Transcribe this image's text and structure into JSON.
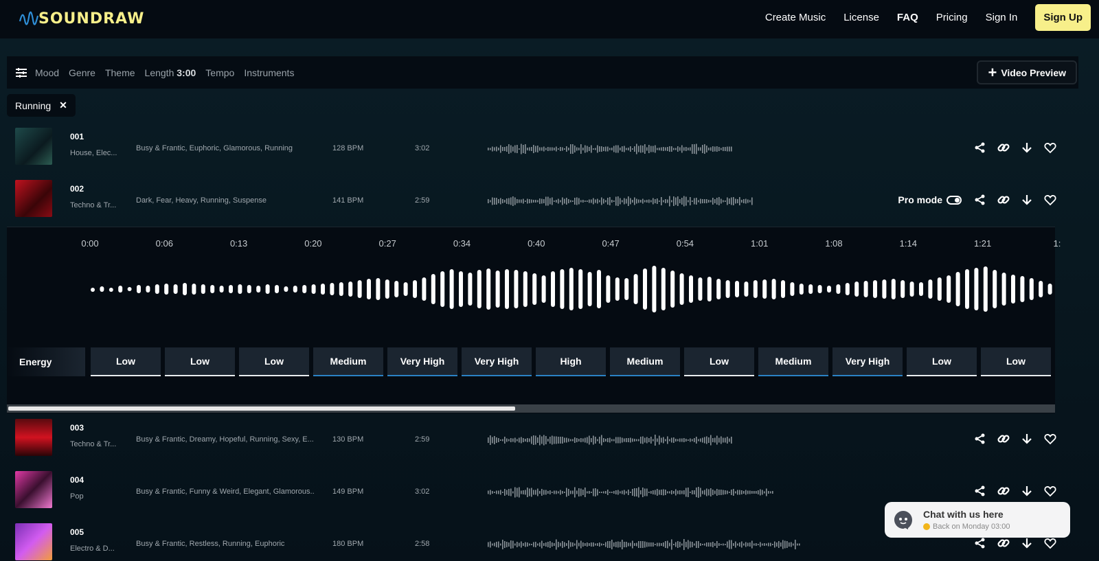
{
  "header": {
    "logo_text": "SOUNDRAW",
    "nav": [
      "Create Music",
      "License",
      "FAQ",
      "Pricing",
      "Sign In"
    ],
    "signup_label": "Sign Up"
  },
  "filters": {
    "items": [
      "Mood",
      "Genre",
      "Theme"
    ],
    "length_label": "Length",
    "length_value": "3:00",
    "tempo": "Tempo",
    "instruments": "Instruments",
    "video_preview": "Video Preview"
  },
  "active_chip": "Running",
  "tracks": [
    {
      "num": "001",
      "genre": "House, Elec...",
      "moods": "Busy & Frantic, Euphoric, Glamorous, Running",
      "bpm": "128 BPM",
      "duration": "3:02"
    },
    {
      "num": "002",
      "genre": "Techno & Tr...",
      "moods": "Dark, Fear, Heavy, Running, Suspense",
      "bpm": "141 BPM",
      "duration": "2:59",
      "pro_mode": "Pro mode"
    },
    {
      "num": "003",
      "genre": "Techno & Tr...",
      "moods": "Busy & Frantic, Dreamy, Hopeful, Running, Sexy, E...",
      "bpm": "130 BPM",
      "duration": "2:59"
    },
    {
      "num": "004",
      "genre": "Pop",
      "moods": "Busy & Frantic, Funny & Weird, Elegant, Glamorous...",
      "bpm": "149 BPM",
      "duration": "3:02"
    },
    {
      "num": "005",
      "genre": "Electro & D...",
      "moods": "Busy & Frantic, Restless, Running, Euphoric",
      "bpm": "180 BPM",
      "duration": "2:58"
    }
  ],
  "timeline": [
    "0:00",
    "0:06",
    "0:13",
    "0:20",
    "0:27",
    "0:34",
    "0:40",
    "0:47",
    "0:54",
    "1:01",
    "1:08",
    "1:14",
    "1:21",
    "1:"
  ],
  "energy": {
    "label": "Energy",
    "cells": [
      "Low",
      "Low",
      "Low",
      "Medium",
      "Very High",
      "Very High",
      "High",
      "Medium",
      "Low",
      "Medium",
      "Very High",
      "Low",
      "Low"
    ]
  },
  "chat": {
    "title": "Chat with us here",
    "status": "Back on Monday 03:00"
  },
  "colors": {
    "accent": "#f7ef8a",
    "energy_blue": "#2a82c4"
  }
}
